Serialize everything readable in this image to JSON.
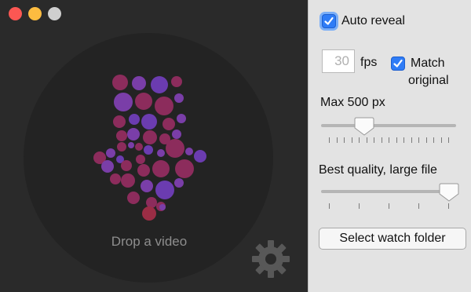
{
  "left": {
    "drop_label": "Drop a video",
    "icons": {
      "drop": "down-arrow-dots-icon",
      "settings": "gear-icon"
    }
  },
  "panel": {
    "auto_reveal": {
      "label": "Auto reveal",
      "checked": true
    },
    "fps": {
      "value": "30",
      "label": "fps"
    },
    "match_original": {
      "label_line1": "Match",
      "label_line2": "original",
      "checked": true
    },
    "size_slider": {
      "label": "Max 500 px",
      "value_fraction": 0.3
    },
    "quality_slider": {
      "label": "Best quality, large file",
      "value_fraction": 1.0
    },
    "select_folder_button": "Select watch folder"
  },
  "colors": {
    "accent": "#2f7cf6",
    "dot_purple": "#7a3ea8",
    "dot_magenta": "#8c2c5c"
  }
}
